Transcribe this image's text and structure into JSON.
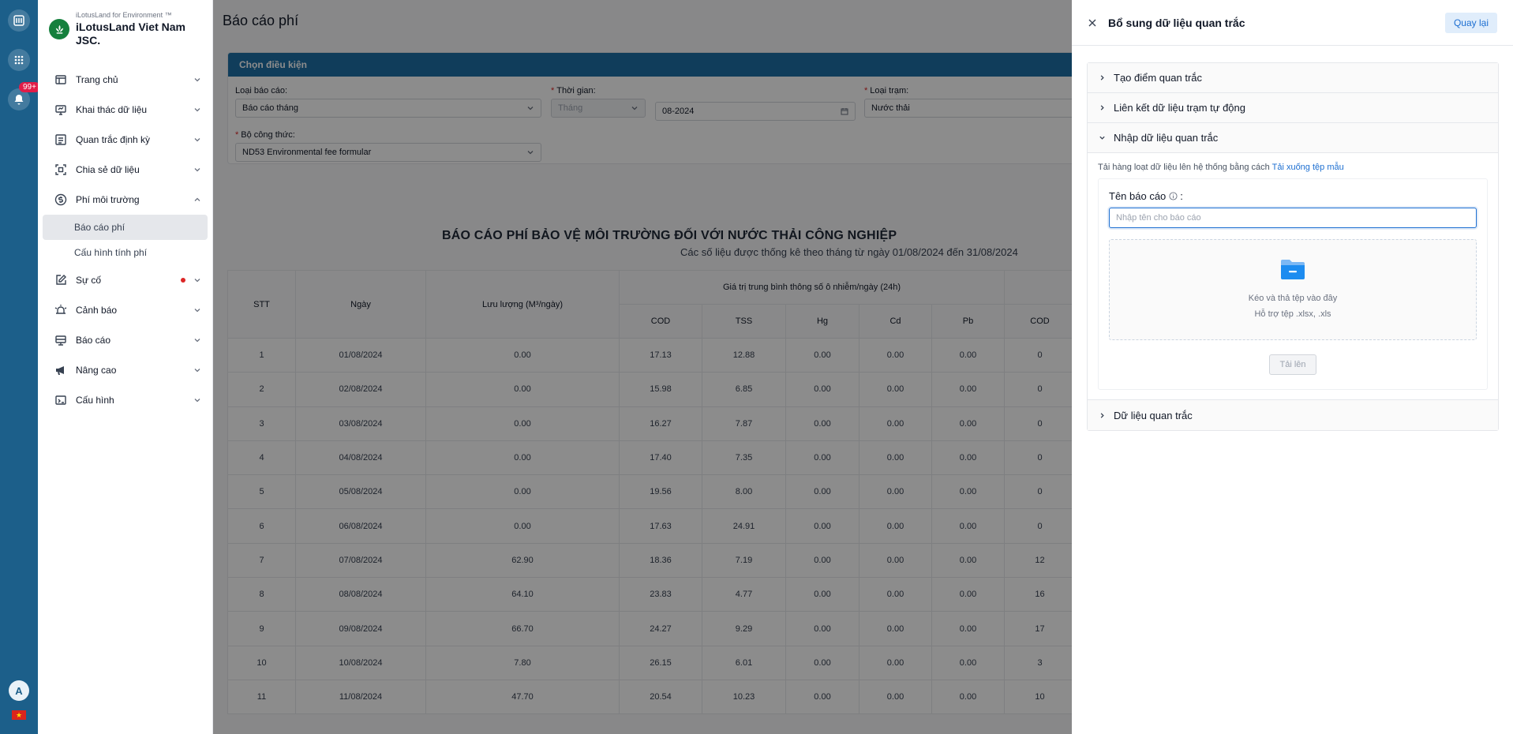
{
  "rail": {
    "badge": "99+",
    "avatar": "A",
    "flag_star": "★"
  },
  "brand": {
    "sub": "iLotusLand for Environment ™",
    "name": "iLotusLand Viet Nam JSC."
  },
  "menu": [
    {
      "label": "Trang chủ",
      "icon": "layout-icon"
    },
    {
      "label": "Khai thác dữ liệu",
      "icon": "monitor-icon"
    },
    {
      "label": "Quan trắc định kỳ",
      "icon": "list-icon"
    },
    {
      "label": "Chia sẻ dữ liệu",
      "icon": "share-icon"
    },
    {
      "label": "Phí môi trường",
      "icon": "dollar-icon",
      "open": true
    },
    {
      "label": "Sự cố",
      "icon": "edit-icon",
      "dot": true
    },
    {
      "label": "Cảnh báo",
      "icon": "bell-icon"
    },
    {
      "label": "Báo cáo",
      "icon": "printer-icon"
    },
    {
      "label": "Nâng cao",
      "icon": "megaphone-icon"
    },
    {
      "label": "Cấu hình",
      "icon": "gear-icon"
    }
  ],
  "submenu": [
    "Báo cáo phí",
    "Cấu hình tính phí"
  ],
  "main": {
    "title": "Báo cáo phí",
    "card_title": "Chọn điều kiện",
    "fields": {
      "report_type_label": "Loại báo cáo:",
      "report_type_value": "Báo cáo tháng",
      "time_label": "Thời gian:",
      "time_unit": "Tháng",
      "time_value": "08-2024",
      "station_label": "Loại trạm:",
      "station_value": "Nước thải",
      "formula_label": "Bộ công thức:",
      "formula_value": "ND53 Environmental fee formular"
    },
    "report_title": "BÁO CÁO PHÍ BẢO VỆ MÔI TRƯỜNG ĐỐI VỚI NƯỚC THẢI CÔNG NGHIỆP",
    "report_sub": "Các số liệu được thống kê theo tháng từ ngày 01/08/2024 đến 31/08/2024",
    "table": {
      "h_stt": "STT",
      "h_date": "Ngày",
      "h_flow": "Lưu lượng (M³/ngày)",
      "h_group": "Giá trị trung bình thông số ô nhiễm/ngày (24h)",
      "h_params": [
        "COD",
        "TSS",
        "Hg",
        "Cd",
        "Pb"
      ],
      "h_extra": "COD",
      "rows": [
        [
          "1",
          "01/08/2024",
          "0.00",
          "17.13",
          "12.88",
          "0.00",
          "0.00",
          "0.00",
          "0"
        ],
        [
          "2",
          "02/08/2024",
          "0.00",
          "15.98",
          "6.85",
          "0.00",
          "0.00",
          "0.00",
          "0"
        ],
        [
          "3",
          "03/08/2024",
          "0.00",
          "16.27",
          "7.87",
          "0.00",
          "0.00",
          "0.00",
          "0"
        ],
        [
          "4",
          "04/08/2024",
          "0.00",
          "17.40",
          "7.35",
          "0.00",
          "0.00",
          "0.00",
          "0"
        ],
        [
          "5",
          "05/08/2024",
          "0.00",
          "19.56",
          "8.00",
          "0.00",
          "0.00",
          "0.00",
          "0"
        ],
        [
          "6",
          "06/08/2024",
          "0.00",
          "17.63",
          "24.91",
          "0.00",
          "0.00",
          "0.00",
          "0"
        ],
        [
          "7",
          "07/08/2024",
          "62.90",
          "18.36",
          "7.19",
          "0.00",
          "0.00",
          "0.00",
          "12"
        ],
        [
          "8",
          "08/08/2024",
          "64.10",
          "23.83",
          "4.77",
          "0.00",
          "0.00",
          "0.00",
          "16"
        ],
        [
          "9",
          "09/08/2024",
          "66.70",
          "24.27",
          "9.29",
          "0.00",
          "0.00",
          "0.00",
          "17"
        ],
        [
          "10",
          "10/08/2024",
          "7.80",
          "26.15",
          "6.01",
          "0.00",
          "0.00",
          "0.00",
          "3"
        ],
        [
          "11",
          "11/08/2024",
          "47.70",
          "20.54",
          "10.23",
          "0.00",
          "0.00",
          "0.00",
          "10"
        ]
      ]
    }
  },
  "drawer": {
    "title": "Bổ sung dữ liệu quan trắc",
    "back_label": "Quay lại",
    "panels": {
      "p1": "Tạo điểm quan trắc",
      "p2": "Liên kết dữ liệu trạm tự động",
      "p3": "Nhập dữ liệu quan trắc",
      "p4": "Dữ liệu quan trắc"
    },
    "upload_hint": "Tải hàng loạt dữ liệu lên hệ thống bằng cách",
    "template_link": "Tải xuống tệp mẫu",
    "name_label": "Tên báo cáo",
    "name_colon": ":",
    "name_placeholder": "Nhập tên cho báo cáo",
    "dropzone_line1": "Kéo và thả tệp vào đây",
    "dropzone_line2": "Hỗ trợ tệp .xlsx, .xls",
    "upload_button": "Tải lên"
  },
  "colors": {
    "rail": "#1c5f8a",
    "card_head": "#1e6fa7",
    "accent": "#1d6fd1",
    "brand": "#15803d"
  }
}
